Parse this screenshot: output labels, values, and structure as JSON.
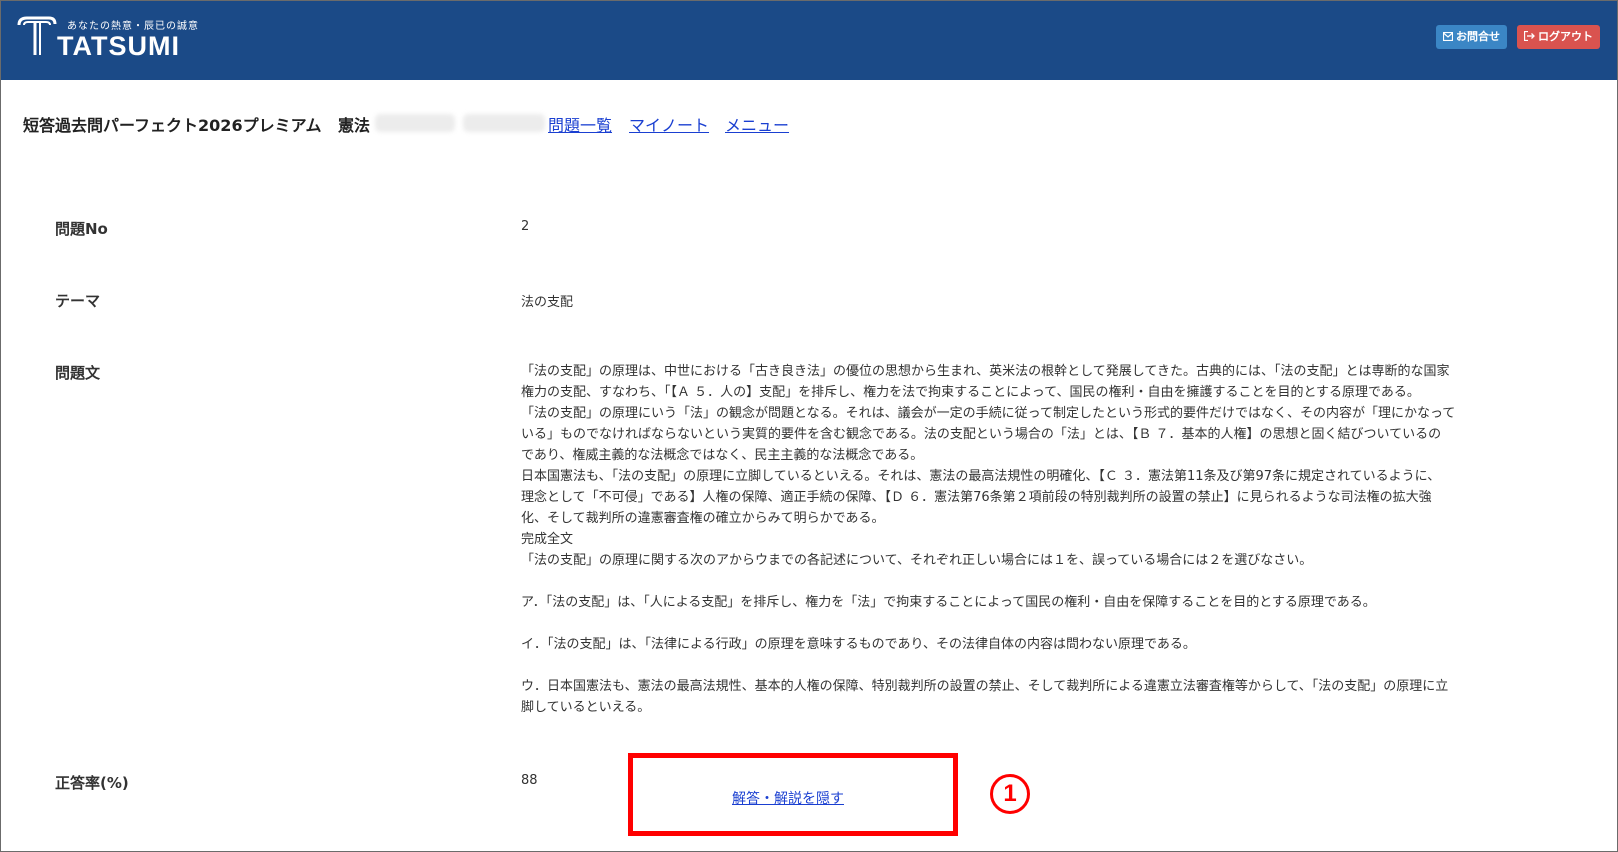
{
  "header": {
    "tagline": "あなたの熱意・辰已の誠意",
    "brand": "TATSUMI",
    "contact_label": "お問合せ",
    "logout_label": "ログアウト",
    "colors": {
      "bar": "#1b4a87",
      "contact": "#3b86c5",
      "logout": "#d9534f"
    }
  },
  "titlebar": {
    "course": "短答過去問パーフェクト2026プレミアム",
    "subject": "憲法",
    "links": [
      "問題一覧",
      "マイノート",
      "メニュー"
    ]
  },
  "fields": {
    "number_label": "問題No",
    "number_value": "2",
    "theme_label": "テーマ",
    "theme_value": "法の支配",
    "question_label": "問題文",
    "question_lines": [
      "「法の支配」の原理は、中世における「古き良き法」の優位の思想から生まれ、英米法の根幹として発展してきた。古典的には、「法の支配」とは専断的な国家",
      "権力の支配、すなわち、「【Ａ ５．人の】支配」を排斥し、権力を法で拘束することによって、国民の権利・自由を擁護することを目的とする原理である。",
      "「法の支配」の原理にいう「法」の観念が問題となる。それは、議会が一定の手続に従って制定したという形式的要件だけではなく、その内容が「理にかなって",
      "いる」ものでなければならないという実質的要件を含む観念である。法の支配という場合の「法」とは、【Ｂ ７．基本的人権】の思想と固く結びついているの",
      "であり、権威主義的な法概念ではなく、民主主義的な法概念である。",
      "日本国憲法も、「法の支配」の原理に立脚しているといえる。それは、憲法の最高法規性の明確化、【Ｃ ３．憲法第11条及び第97条に規定されているように、",
      "理念として「不可侵」である】人権の保障、適正手続の保障、【Ｄ ６．憲法第76条第２項前段の特別裁判所の設置の禁止】に見られるような司法権の拡大強",
      "化、そして裁判所の違憲審査権の確立からみて明らかである。",
      "完成全文",
      "「法の支配」の原理に関する次のアからウまでの各記述について、それぞれ正しい場合には１を、誤っている場合には２を選びなさい。",
      "",
      "ア．「法の支配」は、「人による支配」を排斥し、権力を「法」で拘束することによって国民の権利・自由を保障することを目的とする原理である。",
      "",
      "イ．「法の支配」は、「法律による行政」の原理を意味するものであり、その法律自体の内容は問わない原理である。",
      "",
      "ウ．日本国憲法も、憲法の最高法規性、基本的人権の保障、特別裁判所の設置の禁止、そして裁判所による違憲立法審査権等からして、「法の支配」の原理に立",
      "脚しているといえる。"
    ],
    "rate_label": "正答率(%)",
    "rate_value": "88"
  },
  "actions": {
    "toggle_answer": "解答・解説を隠す",
    "marker": "1"
  }
}
